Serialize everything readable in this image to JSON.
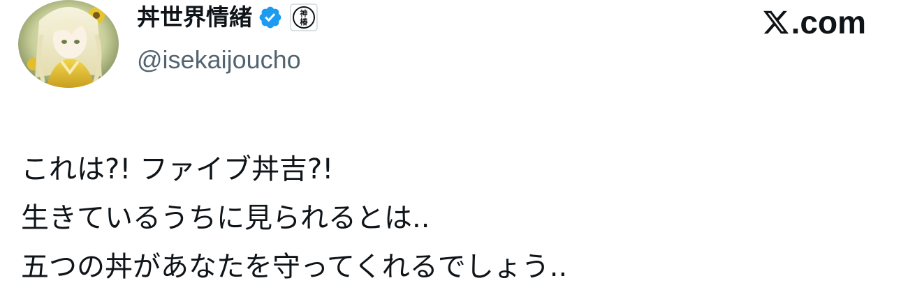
{
  "user": {
    "display_name": "丼世界情緒",
    "handle": "@isekaijoucho",
    "verified": true,
    "verified_icon": "verified-badge-icon",
    "verified_color": "#1d9bf0",
    "affiliate_badge_icon": "affiliate-badge-icon",
    "affiliate_badge_text": "神椿",
    "avatar_icon": "avatar-image"
  },
  "brand": {
    "logo_text": ".com",
    "logo_icon": "x-logo-icon"
  },
  "tweet": {
    "lines": [
      "これは?! ファイブ丼吉?!",
      "生きているうちに見られるとは..",
      "五つの丼があなたを守ってくれるでしょう.."
    ]
  },
  "colors": {
    "text_primary": "#0f1419",
    "text_secondary": "#536471",
    "background": "#ffffff"
  }
}
